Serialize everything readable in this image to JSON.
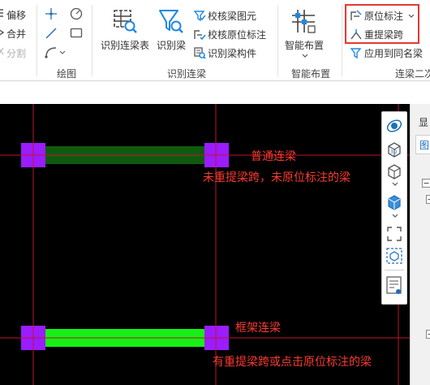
{
  "ribbon": {
    "modify": {
      "offset": "偏移",
      "merge": "合并",
      "split": "分割"
    },
    "draw": {
      "group_label": "绘图"
    },
    "identify": {
      "identify_table": "识别连梁表",
      "identify_beam": "识别梁",
      "check_element": "校核梁图元",
      "check_annotation": "校核原位标注",
      "identify_component": "识别梁构件",
      "group_label": "识别连梁"
    },
    "smart": {
      "smart_layout": "智能布置",
      "group_label": "智能布置"
    },
    "secondary": {
      "in_situ": "原位标注",
      "repick_span": "重提梁跨",
      "apply_same_name": "应用到同名梁",
      "group_label": "连梁二次"
    }
  },
  "canvas": {
    "beam_ordinary_label": "普通连梁",
    "beam_ordinary_note": "未重提梁跨，未原位标注的梁",
    "beam_frame_label": "框架连梁",
    "beam_frame_note": "有重提梁跨或点击原位标注的梁"
  },
  "side_panel": {
    "top_text": "显",
    "tab_text": "图"
  },
  "colors": {
    "highlight": "#e53935",
    "annotation": "#ff3b30",
    "column": "#9b1cff",
    "beam_ordinary": "#0f5a0f",
    "beam_frame": "#16f016",
    "axis": "#c0142e"
  },
  "icons": {
    "offset": "offset-icon",
    "merge": "merge-icon",
    "split": "split-icon",
    "point": "point-icon",
    "line": "line-icon",
    "arc": "arc-icon",
    "circle": "circle-icon",
    "rect": "rect-icon",
    "identify_table": "table-scan-icon",
    "identify_beam": "beam-scan-icon",
    "smart_layout": "grid-layout-icon"
  }
}
